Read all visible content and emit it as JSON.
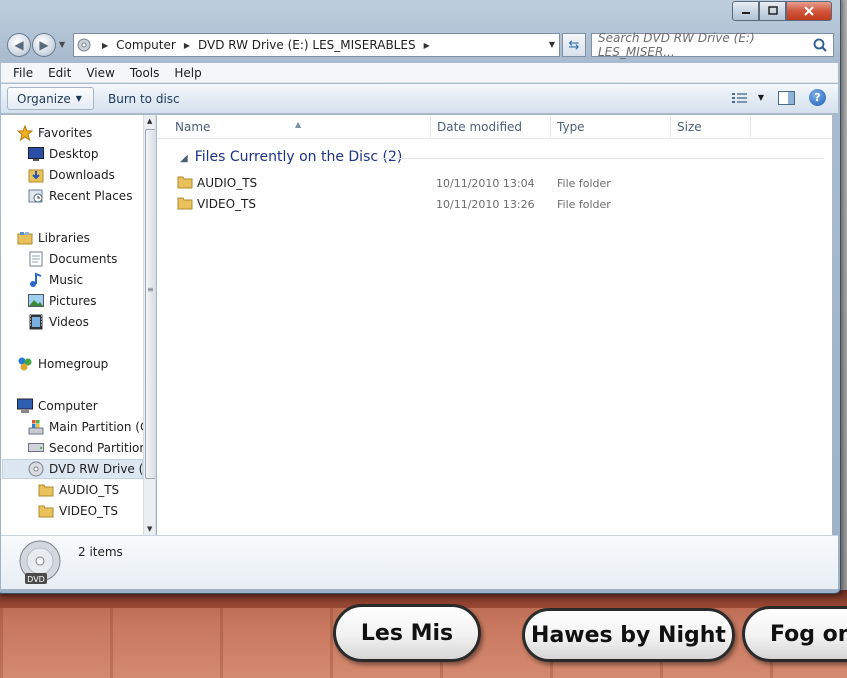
{
  "address": {
    "crumbs": [
      "Computer",
      "DVD RW Drive (E:) LES_MISERABLES"
    ]
  },
  "search": {
    "placeholder": "Search DVD RW Drive (E:) LES_MISER..."
  },
  "menu": [
    "File",
    "Edit",
    "View",
    "Tools",
    "Help"
  ],
  "toolbar": {
    "organize": "Organize",
    "burn": "Burn to disc"
  },
  "nav": {
    "favorites": "Favorites",
    "desktop": "Desktop",
    "downloads": "Downloads",
    "recent": "Recent Places",
    "libraries": "Libraries",
    "documents": "Documents",
    "music": "Music",
    "pictures": "Pictures",
    "videos": "Videos",
    "homegroup": "Homegroup",
    "computer": "Computer",
    "main_partition": "Main Partition (C",
    "second_partition": "Second Partition",
    "dvd_drive": "DVD RW Drive (E:",
    "audio_ts": "AUDIO_TS",
    "video_ts": "VIDEO_TS"
  },
  "columns": {
    "name": "Name",
    "date": "Date modified",
    "type": "Type",
    "size": "Size"
  },
  "group_title": "Files Currently on the Disc (2)",
  "files": [
    {
      "name": "AUDIO_TS",
      "date": "10/11/2010 13:04",
      "type": "File folder"
    },
    {
      "name": "VIDEO_TS",
      "date": "10/11/2010 13:26",
      "type": "File folder"
    }
  ],
  "details": {
    "count": "2 items",
    "badge": "DVD"
  },
  "background_buttons": [
    "Les Mis",
    "Hawes by Night",
    "Fog on t"
  ],
  "colors": {
    "accent": "#1e3287",
    "selected": "#dde7f2",
    "toolbar_text": "#1e395b"
  }
}
